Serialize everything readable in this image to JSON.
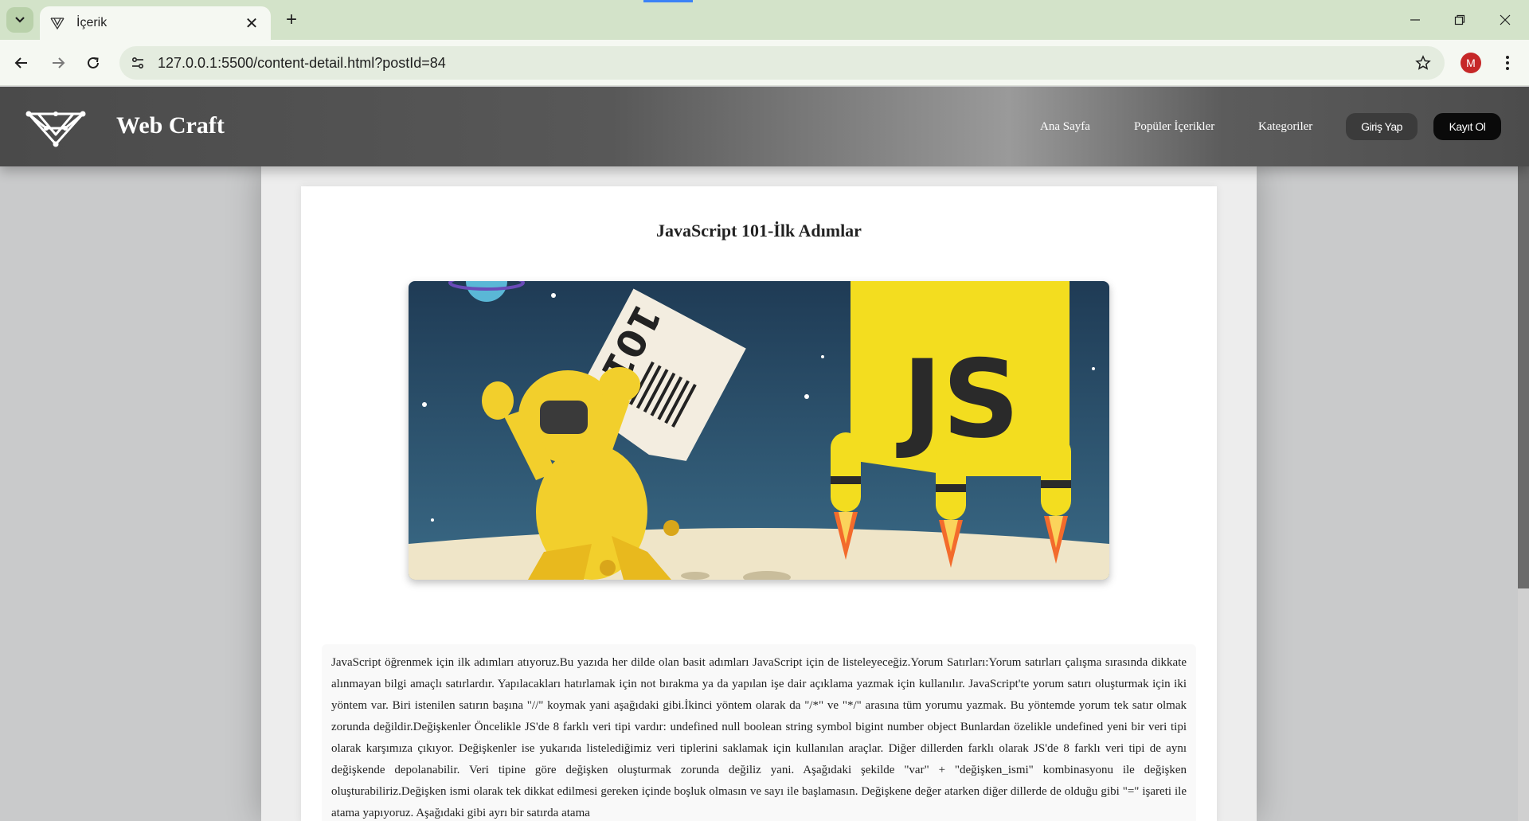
{
  "browser": {
    "tab_title": "İçerik",
    "tab_close": "✕",
    "new_tab": "+",
    "url": "127.0.0.1:5500/content-detail.html?postId=84",
    "profile_initial": "M"
  },
  "header": {
    "brand": "Web Craft",
    "nav": [
      "Ana Sayfa",
      "Popüler İçerikler",
      "Kategoriler"
    ],
    "login_label": "Giriş Yap",
    "register_label": "Kayıt Ol"
  },
  "post": {
    "title": "JavaScript 101-İlk Adımlar",
    "image": {
      "alt": "Astronaut holding a 101 ticket beside a JS rocket",
      "ticket_text": "101",
      "badge_text": "JS"
    },
    "content": "JavaScript öğrenmek için ilk adımları atıyoruz.Bu yazıda her dilde olan basit adımları JavaScript için de listeleyeceğiz.Yorum Satırları:Yorum satırları çalışma sırasında dikkate alınmayan bilgi amaçlı satırlardır. Yapılacakları hatırlamak için not bırakma ya da yapılan işe dair açıklama yazmak için kullanılır. JavaScript'te yorum satırı oluşturmak için iki yöntem var. Biri istenilen satırın başına \"//\" koymak yani aşağıdaki gibi.İkinci yöntem olarak da \"/*\" ve \"*/\" arasına tüm yorumu yazmak. Bu yöntemde yorum tek satır olmak zorunda değildir.Değişkenler Öncelikle JS'de 8 farklı veri tipi vardır: undefined null boolean string symbol bigint number object Bunlardan özelikle undefined yeni bir veri tipi olarak karşımıza çıkıyor. Değişkenler ise yukarıda listelediğimiz veri tiplerini saklamak için kullanılan araçlar. Diğer dillerden farklı olarak JS'de 8 farklı veri tipi de aynı değişkende depolanabilir. Veri tipine göre değişken oluşturmak zorunda değiliz yani. Aşağıdaki şekilde \"var\" + \"değişken_ismi\" kombinasyonu ile değişken oluşturabiliriz.Değişken ismi olarak tek dikkat edilmesi gereken içinde boşluk olmasın ve sayı ile başlamasın. Değişkene değer atarken diğer dillerde de olduğu gibi \"=\" işareti ile atama yapıyoruz. Aşağıdaki gibi ayrı bir satırda atama"
  },
  "colors": {
    "header_dark": "#4a4a4a",
    "register_button": "#0a0a0a",
    "login_button": "#3b3b3b",
    "js_yellow": "#f3dd1f",
    "space_blue": "#2a4f6a"
  },
  "icons": [
    "tab-search-icon",
    "web-craft-favicon",
    "close-icon",
    "plus-icon",
    "minimize-icon",
    "restore-icon",
    "window-close-icon",
    "back-arrow-icon",
    "forward-arrow-icon",
    "reload-icon",
    "site-info-icon",
    "bookmark-star-icon",
    "more-menu-icon",
    "web-craft-logo-icon"
  ]
}
